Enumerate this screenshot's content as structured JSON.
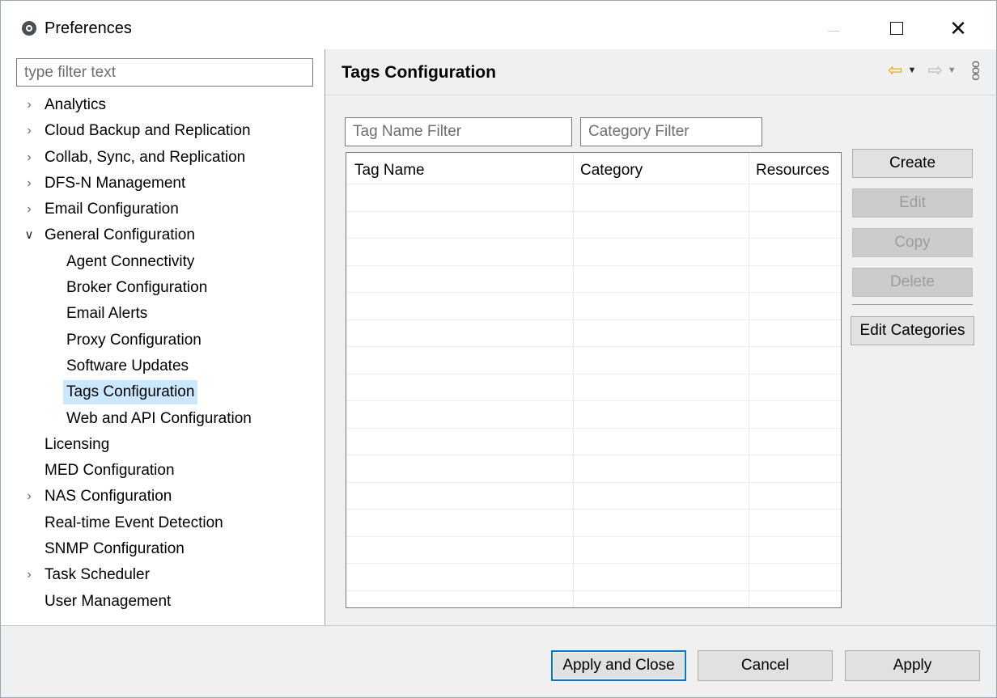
{
  "window": {
    "title": "Preferences",
    "app_icon": "app-logo-icon",
    "controls": {
      "minimize": "minimize-icon",
      "maximize": "maximize-icon",
      "close": "close-icon"
    }
  },
  "filter": {
    "placeholder": "type filter text",
    "value": ""
  },
  "tree": [
    {
      "label": "Analytics",
      "level": 0,
      "expander": "collapsed"
    },
    {
      "label": "Cloud Backup and Replication",
      "level": 0,
      "expander": "collapsed"
    },
    {
      "label": "Collab, Sync, and Replication",
      "level": 0,
      "expander": "collapsed"
    },
    {
      "label": "DFS-N Management",
      "level": 0,
      "expander": "collapsed"
    },
    {
      "label": "Email Configuration",
      "level": 0,
      "expander": "collapsed"
    },
    {
      "label": "General Configuration",
      "level": 0,
      "expander": "expanded"
    },
    {
      "label": "Agent Connectivity",
      "level": 1,
      "expander": "none"
    },
    {
      "label": "Broker Configuration",
      "level": 1,
      "expander": "none"
    },
    {
      "label": "Email Alerts",
      "level": 1,
      "expander": "none"
    },
    {
      "label": "Proxy Configuration",
      "level": 1,
      "expander": "none"
    },
    {
      "label": "Software Updates",
      "level": 1,
      "expander": "none"
    },
    {
      "label": "Tags Configuration",
      "level": 1,
      "expander": "none",
      "selected": true
    },
    {
      "label": "Web and API Configuration",
      "level": 1,
      "expander": "none"
    },
    {
      "label": "Licensing",
      "level": 0,
      "expander": "none"
    },
    {
      "label": "MED Configuration",
      "level": 0,
      "expander": "none"
    },
    {
      "label": "NAS Configuration",
      "level": 0,
      "expander": "collapsed"
    },
    {
      "label": "Real-time Event Detection",
      "level": 0,
      "expander": "none"
    },
    {
      "label": "SNMP Configuration",
      "level": 0,
      "expander": "none"
    },
    {
      "label": "Task Scheduler",
      "level": 0,
      "expander": "collapsed"
    },
    {
      "label": "User Management",
      "level": 0,
      "expander": "none"
    }
  ],
  "page": {
    "title": "Tags Configuration",
    "nav": {
      "back": "back-arrow-icon",
      "forward": "forward-arrow-icon",
      "menu": "view-menu-icon"
    }
  },
  "filters": {
    "tag_name_placeholder": "Tag Name Filter",
    "category_placeholder": "Category Filter"
  },
  "table": {
    "columns": [
      "Tag Name",
      "Category",
      "Resources"
    ],
    "rows": []
  },
  "buttons": {
    "create": "Create",
    "edit": "Edit",
    "copy": "Copy",
    "delete": "Delete",
    "edit_categories": "Edit Categories"
  },
  "footer": {
    "apply_and_close": "Apply and Close",
    "cancel": "Cancel",
    "apply": "Apply"
  },
  "colors": {
    "selection": "#cce8ff",
    "default_button_border": "#0078d7",
    "back_arrow": "#e0a800"
  }
}
